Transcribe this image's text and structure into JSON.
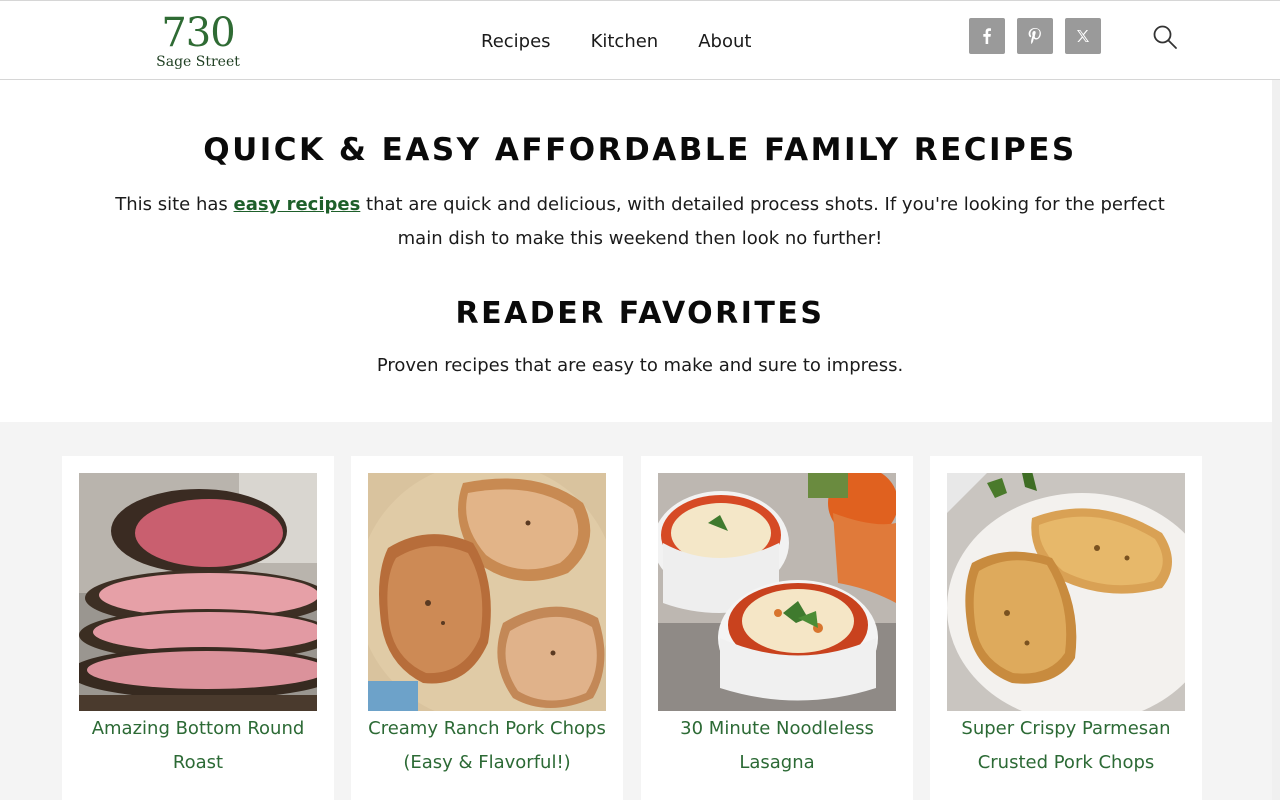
{
  "header": {
    "logo_number": "730",
    "logo_subtitle": "Sage Street",
    "nav": [
      "Recipes",
      "Kitchen",
      "About"
    ],
    "social": [
      {
        "name": "facebook-icon",
        "glyph": "f"
      },
      {
        "name": "pinterest-icon",
        "glyph": "p"
      },
      {
        "name": "x-twitter-icon",
        "glyph": "x"
      }
    ]
  },
  "intro": {
    "heading": "QUICK & EASY AFFORDABLE FAMILY RECIPES",
    "lead_before": "This site has ",
    "lead_link": "easy recipes",
    "lead_after": " that are quick and delicious, with detailed process shots. If you're looking for the perfect main dish to make this weekend then look no further!",
    "favorites_heading": "READER FAVORITES",
    "favorites_sub": "Proven recipes that are easy to make and sure to impress."
  },
  "cards": [
    {
      "title": "Amazing Bottom Round Roast"
    },
    {
      "title": "Creamy Ranch Pork Chops (Easy & Flavorful!)"
    },
    {
      "title": "30 Minute Noodleless Lasagna"
    },
    {
      "title": "Super Crispy Parmesan Crusted Pork Chops"
    }
  ],
  "colors": {
    "brand_green": "#2f6b34",
    "link_green": "#1e5f2a",
    "card_title_green": "#2c6a35",
    "social_gray": "#9a9a9a",
    "section_bg": "#f4f4f4"
  }
}
